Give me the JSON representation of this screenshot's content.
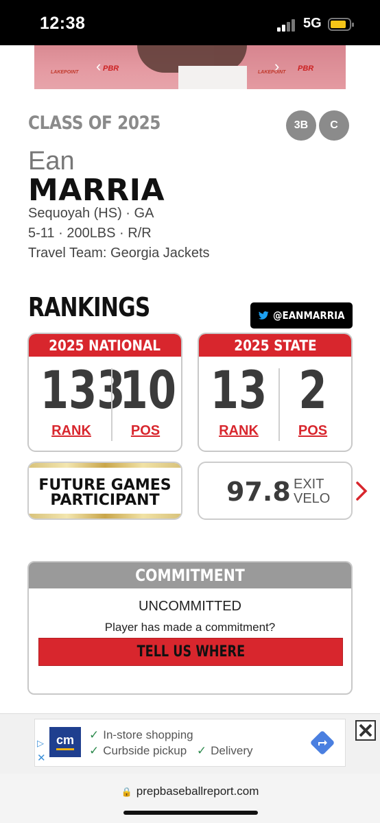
{
  "status_bar": {
    "time": "12:38",
    "network": "5G"
  },
  "carousel": {
    "logo_left": "PBR",
    "logo_right": "PBR",
    "sponsor": "LAKEPOINT"
  },
  "player": {
    "class_of": "CLASS OF 2025",
    "positions": [
      "3B",
      "C"
    ],
    "first_name": "Ean",
    "last_name": "MARRIA",
    "school": "Sequoyah (HS) · GA",
    "measurables": "5-11 · 200LBS · R/R",
    "travel_team": "Travel Team: Georgia Jackets"
  },
  "rankings": {
    "heading": "RANKINGS",
    "twitter_handle": "@EANMARRIA",
    "national": {
      "title": "2025 NATIONAL",
      "rank": "133",
      "pos": "10",
      "rank_label": "RANK",
      "pos_label": "POS"
    },
    "state": {
      "title": "2025 STATE",
      "rank": "13",
      "pos": "2",
      "rank_label": "RANK",
      "pos_label": "POS"
    },
    "future_games": {
      "line1": "FUTURE GAMES",
      "line2": "PARTICIPANT"
    },
    "exit_velo": {
      "value": "97.8",
      "label1": "EXIT",
      "label2": "VELO"
    }
  },
  "commitment": {
    "heading": "COMMITMENT",
    "status": "UNCOMMITTED",
    "question": "Player has made a commitment?",
    "button": "TELL US WHERE"
  },
  "ad": {
    "logo": "cm",
    "line1_items": [
      "In-store shopping"
    ],
    "line2_items": [
      "Curbside pickup",
      "Delivery"
    ]
  },
  "browser": {
    "url": "prepbaseballreport.com"
  },
  "colors": {
    "accent_red": "#d8262d",
    "gray_badge": "#8b8b8b",
    "header_gray": "#9a9a9a"
  }
}
